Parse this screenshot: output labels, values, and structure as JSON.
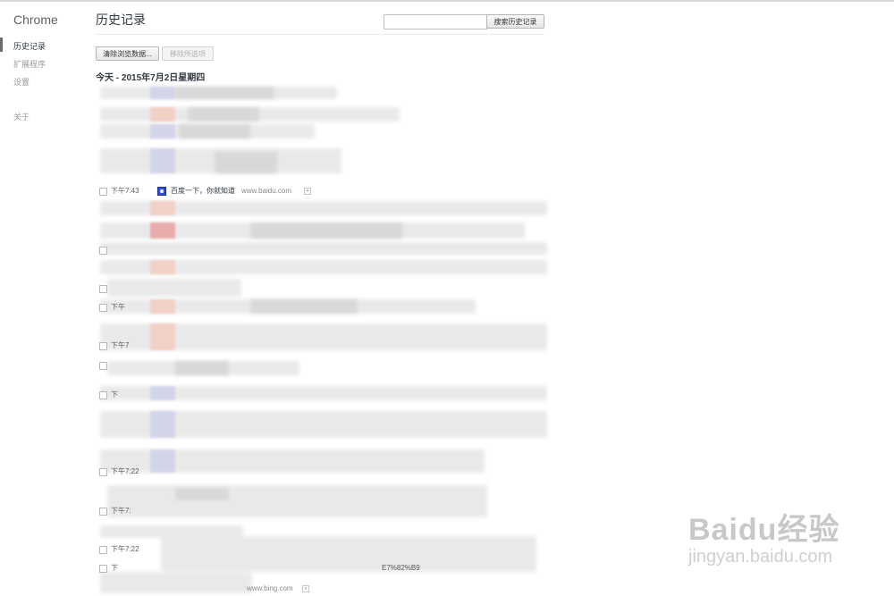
{
  "sidebar": {
    "brand": "Chrome",
    "items": [
      {
        "label": "历史记录"
      },
      {
        "label": "扩展程序"
      },
      {
        "label": "设置"
      },
      {
        "label": "关于"
      }
    ]
  },
  "header": {
    "title": "历史记录",
    "search_placeholder": "",
    "search_button": "搜索历史记录"
  },
  "toolbar": {
    "clear_button": "清除浏览数据...",
    "remove_button": "移除所选项"
  },
  "history": {
    "day_header": "今天 - 2015年7月2日星期四",
    "entries": [
      {
        "time": "下午7:43",
        "title": "百度一下，你就知道",
        "domain": "www.baidu.com"
      },
      {
        "time": "下午7:22",
        "domain": "www.bing.com"
      },
      {
        "time": "下午7:22"
      }
    ],
    "partial_times": [
      "下午",
      "下午7",
      "下午7:",
      "下",
      "下"
    ],
    "fragment_text": "E7%82%B9"
  },
  "watermark": {
    "logo": "Baidu经验",
    "url": "jingyan.baidu.com"
  },
  "colors": {
    "text": "#303942",
    "muted": "#9a9a9a",
    "favicon": "#2f4fd0"
  }
}
